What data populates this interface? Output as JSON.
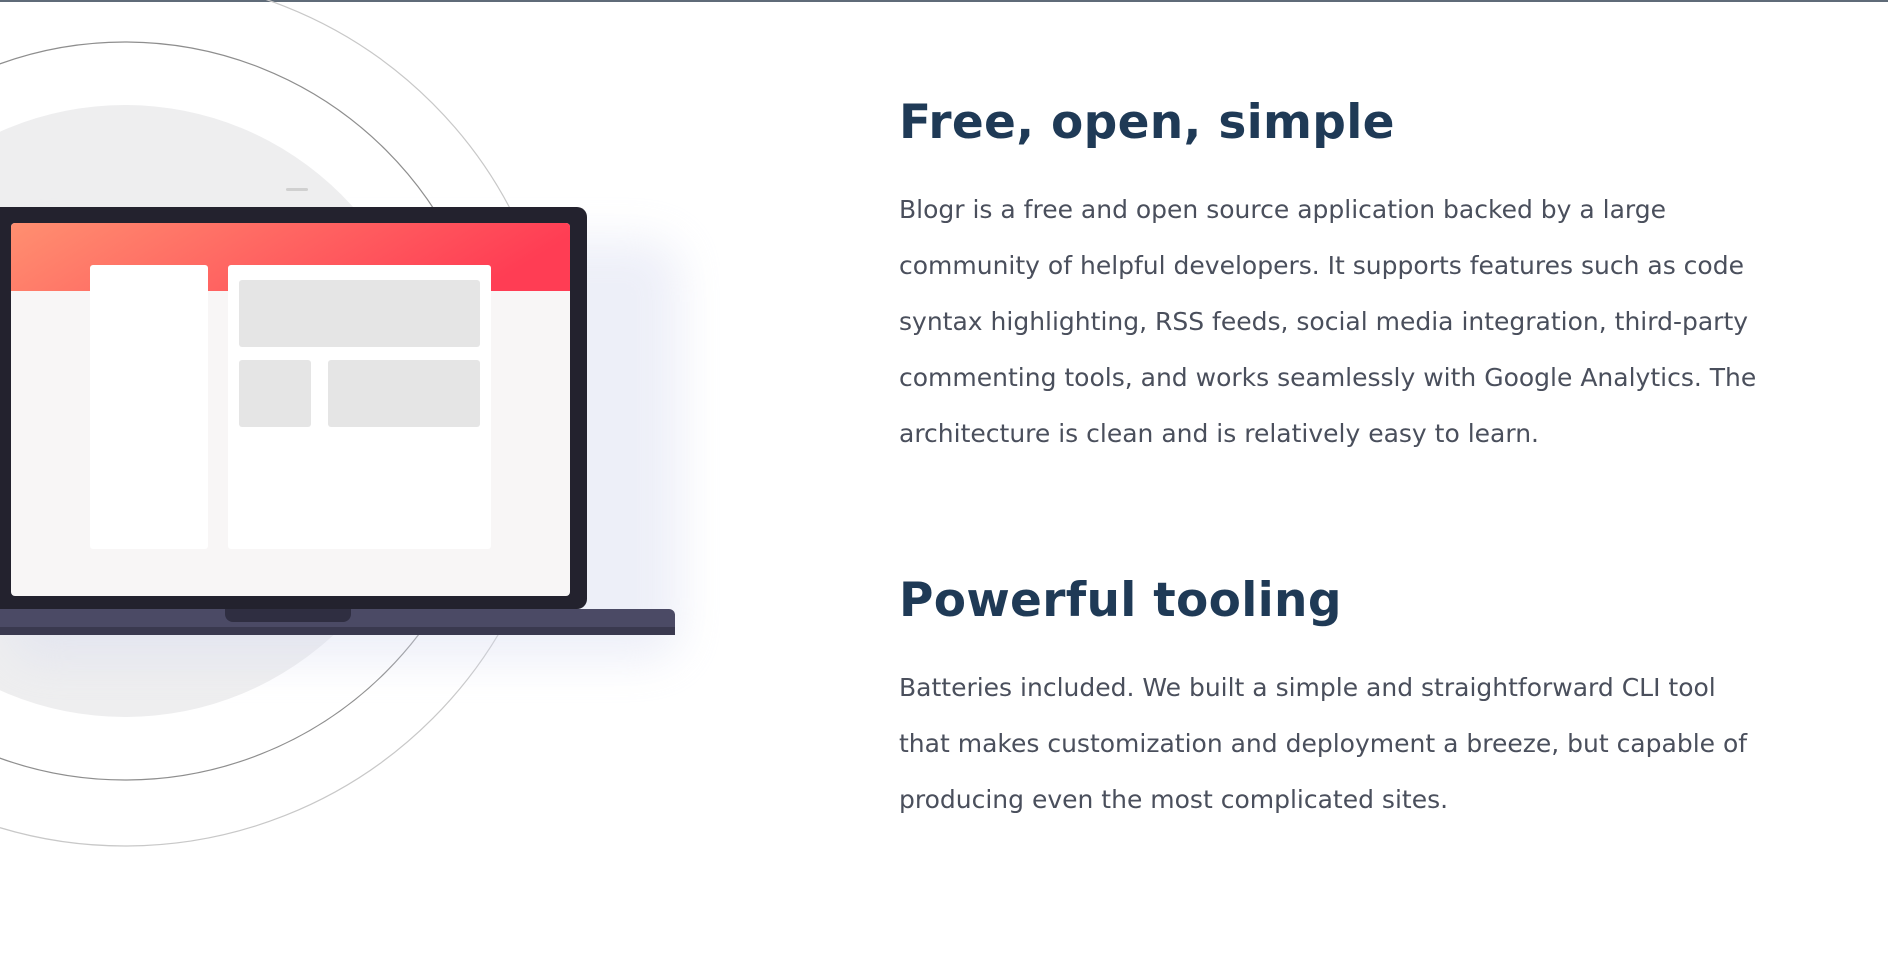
{
  "features": [
    {
      "title": "Free, open, simple",
      "text": "Blogr is a free and open source application backed by a large community of helpful developers. It supports features such as code syntax highlighting, RSS feeds, social media integration, third-party commenting tools, and works seamlessly with Google Analytics. The architecture is clean and is relatively easy to learn."
    },
    {
      "title": "Powerful tooling",
      "text": "Batteries included. We built a simple and straightforward CLI tool that makes customization and deployment a breeze, but capable of producing even the most complicated sites."
    }
  ],
  "colors": {
    "heading": "#1f3a56",
    "body_text": "#4a4f5c",
    "gradient_start": "#ff8f70",
    "gradient_end": "#ff3d54",
    "laptop_frame": "#23222e",
    "laptop_base": "#4b4a65"
  }
}
